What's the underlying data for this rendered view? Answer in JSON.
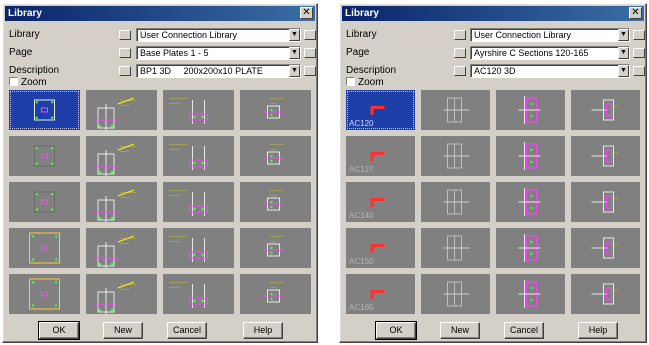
{
  "left": {
    "title": "Library",
    "close_glyph": "✕",
    "fields": [
      {
        "label": "Library",
        "value": "User Connection Library"
      },
      {
        "label": "Page",
        "value": "Base Plates 1 - 5"
      },
      {
        "label": "Description",
        "value": "BP1 3D     200x200x10 PLATE"
      }
    ],
    "zoom_label": "Zoom",
    "selected_tile": 0,
    "buttons": {
      "ok": "OK",
      "new": "New",
      "cancel": "Cancel",
      "help": "Help"
    }
  },
  "right": {
    "title": "Library",
    "fields": [
      {
        "label": "Library",
        "value": "User Connection Library"
      },
      {
        "label": "Page",
        "value": "Ayrshire C Sections 120-165"
      },
      {
        "label": "Description",
        "value": "AC120 3D"
      }
    ],
    "zoom_label": "Zoom",
    "selected_tile": 0,
    "captions": [
      "AC120",
      "AC127",
      "AC140",
      "AC150",
      "AC165"
    ],
    "buttons": {
      "ok": "OK",
      "new": "New",
      "cancel": "Cancel",
      "help": "Help"
    }
  },
  "icons": {
    "dropdown_arrow": "▼",
    "close": "close-icon"
  },
  "colors": {
    "title_bar": "#0a246a",
    "tile_bg": "#808080",
    "tile_selected": "#1e3fa8",
    "member_red": "#ff3030",
    "plate_yellow": "#ffff00",
    "dim_magenta": "#ff40ff",
    "bolt_green": "#40ff40"
  }
}
